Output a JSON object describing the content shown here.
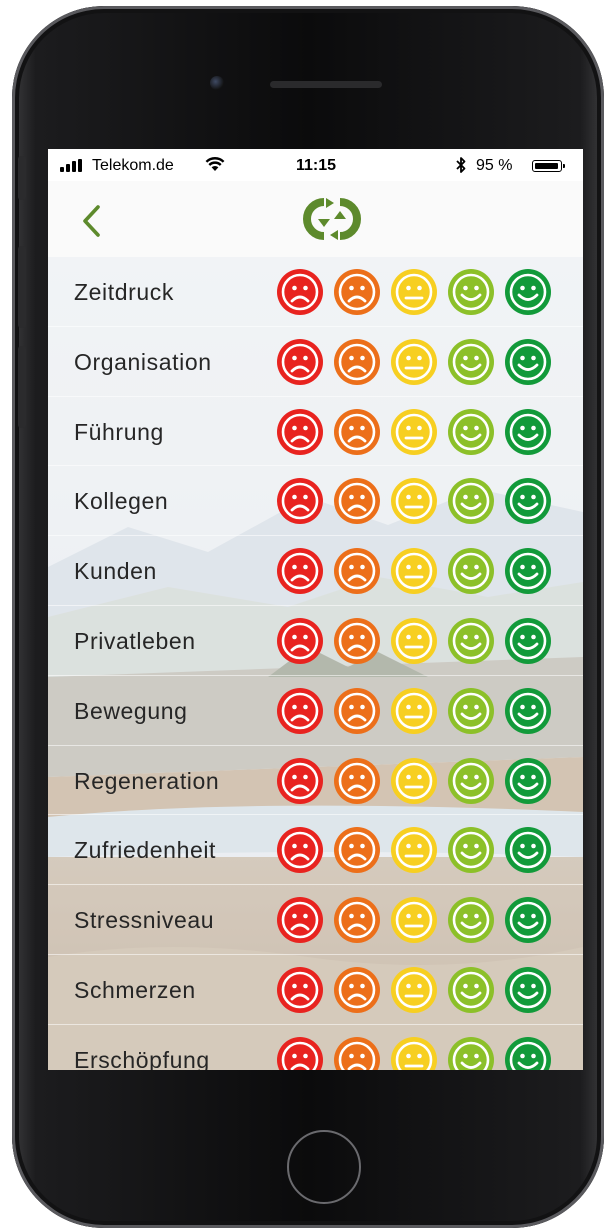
{
  "status_bar": {
    "carrier": "Telekom.de",
    "time": "11:15",
    "battery": "95 %",
    "signal_icon": "signal-bars-icon",
    "wifi_icon": "wifi-icon",
    "bluetooth_icon": "bluetooth-icon",
    "battery_level": 0.95
  },
  "nav": {
    "back_icon": "chevron-left-icon",
    "logo_icon": "app-logo-icon",
    "accent_color": "#5d8a2c"
  },
  "rating_colors": [
    "#e8231f",
    "#ec6f1a",
    "#f7cf21",
    "#8cc029",
    "#129a3a"
  ],
  "rating_moods": [
    "sad",
    "sad",
    "neutral",
    "happy",
    "happy"
  ],
  "categories": [
    {
      "label": "Zeitdruck"
    },
    {
      "label": "Organisation"
    },
    {
      "label": "Führung"
    },
    {
      "label": "Kollegen"
    },
    {
      "label": "Kunden"
    },
    {
      "label": "Privatleben"
    },
    {
      "label": "Bewegung"
    },
    {
      "label": "Regeneration"
    },
    {
      "label": "Zufriedenheit"
    },
    {
      "label": "Stressniveau"
    },
    {
      "label": "Schmerzen"
    },
    {
      "label": "Erschöpfung"
    }
  ]
}
